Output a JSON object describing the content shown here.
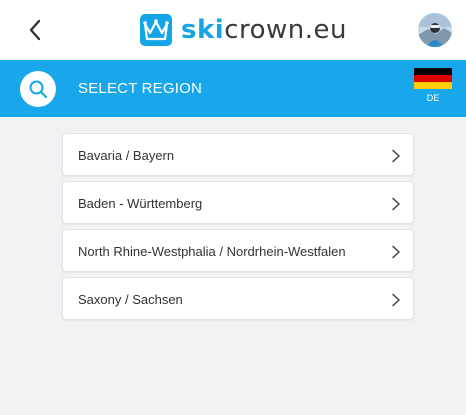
{
  "header": {
    "logo": {
      "ski": "ski",
      "rest": "crown.eu"
    },
    "back_icon": "chevron-left-icon",
    "avatar_icon": "user-avatar"
  },
  "region_bar": {
    "title": "SELECT REGION",
    "search_icon": "search-icon",
    "language_code": "DE",
    "flag": "germany-flag",
    "bar_color": "#17a7ea"
  },
  "regions": [
    {
      "label": "Bavaria / Bayern"
    },
    {
      "label": "Baden - Württemberg"
    },
    {
      "label": "North Rhine-Westphalia / Nordrhein-Westfalen"
    },
    {
      "label": "Saxony / Sachsen"
    }
  ],
  "colors": {
    "accent": "#17a7ea",
    "background": "#f1f2f4",
    "text": "#333333"
  }
}
